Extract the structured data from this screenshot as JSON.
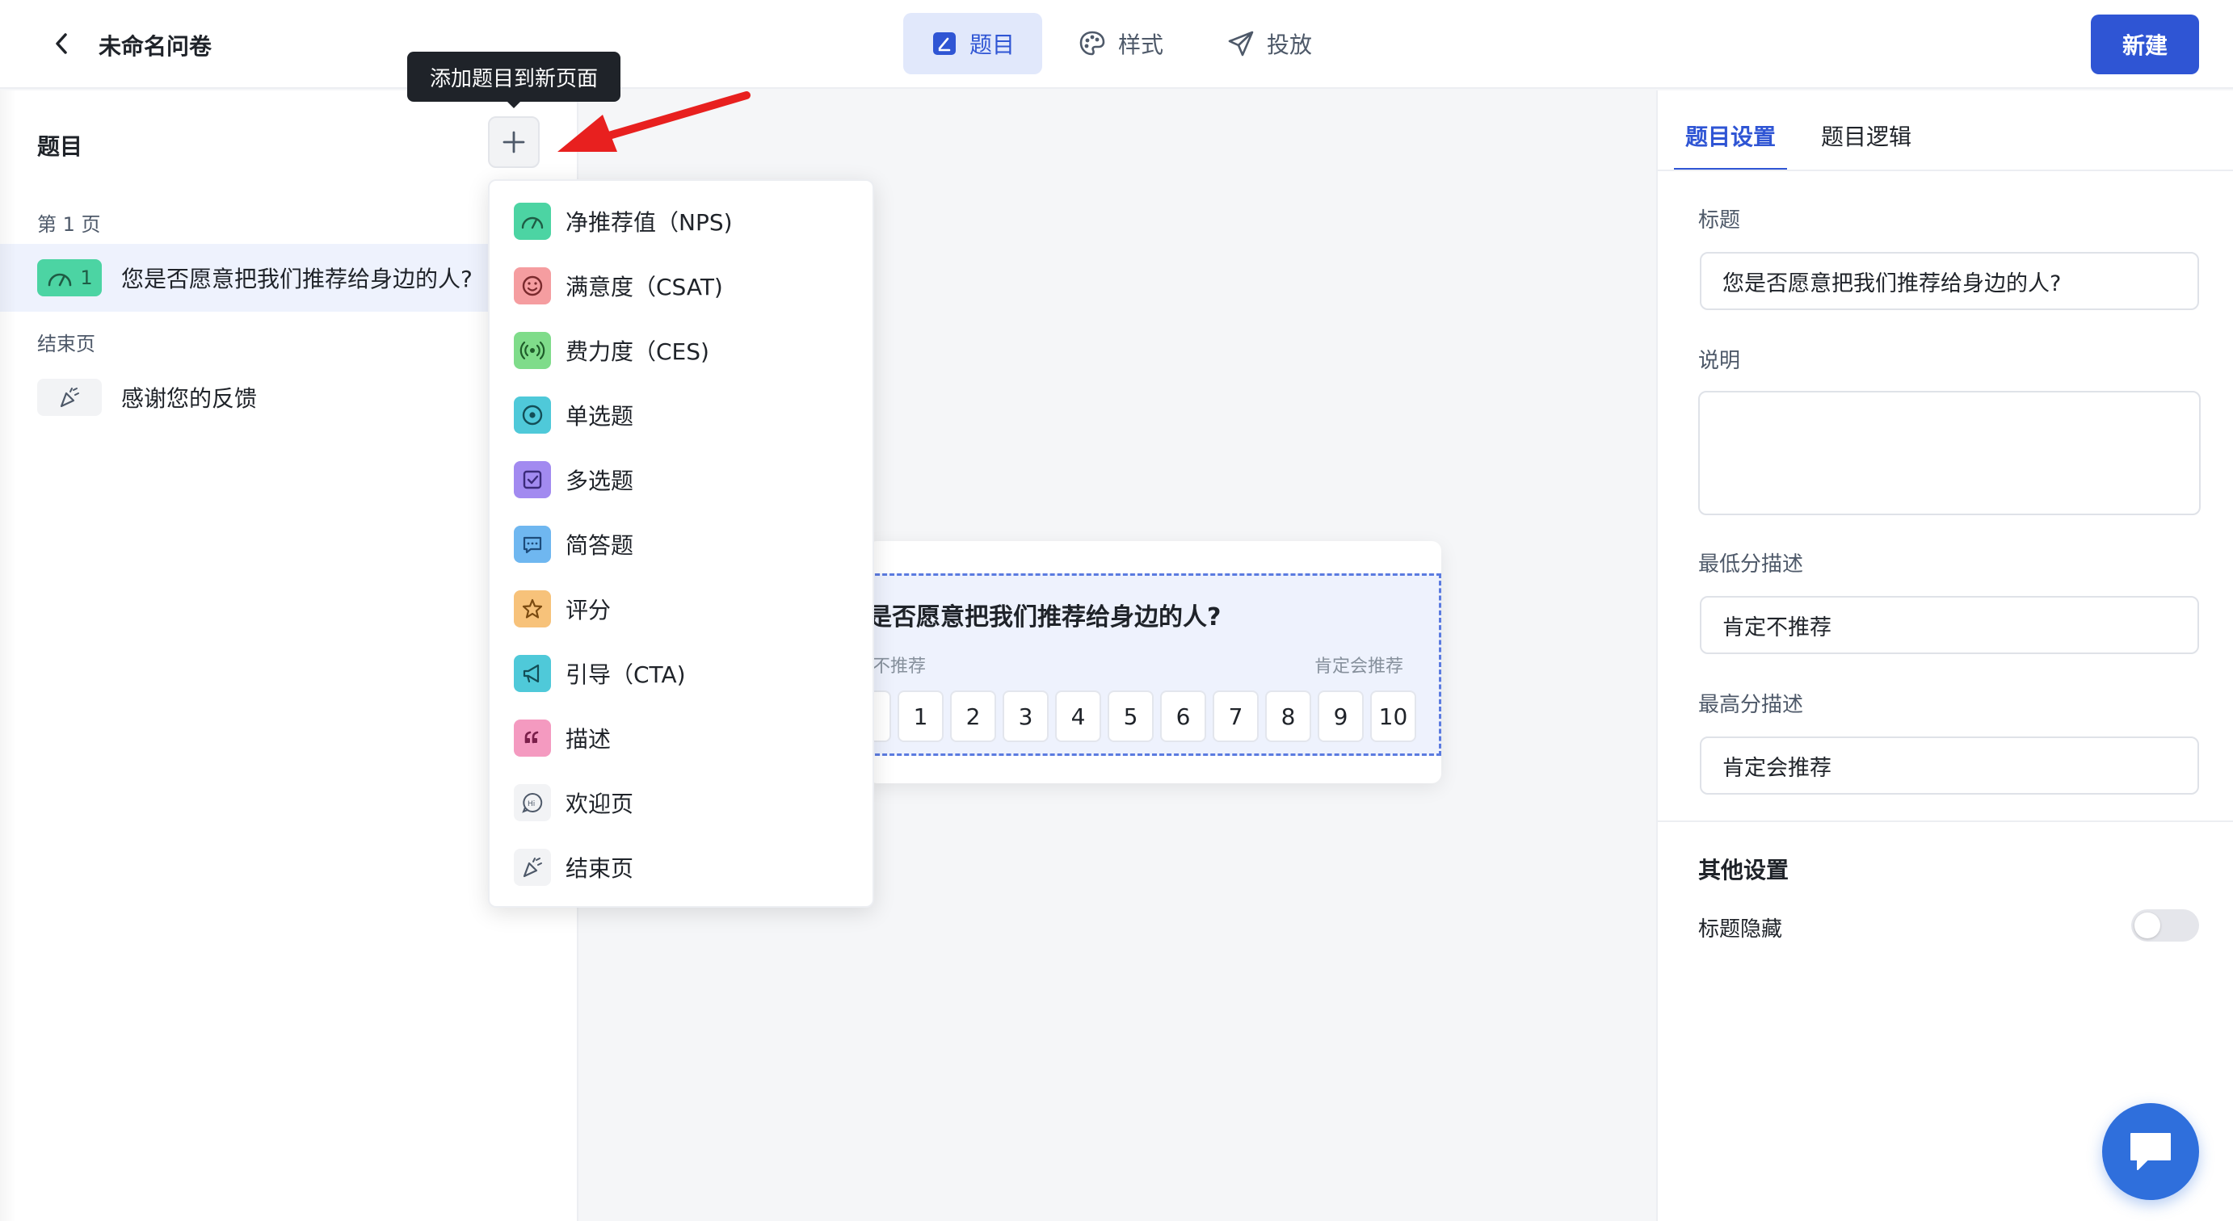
{
  "header": {
    "doc_title": "未命名问卷",
    "tabs": [
      {
        "label": "题目",
        "icon": "edit-note-icon",
        "active": true
      },
      {
        "label": "样式",
        "icon": "palette-icon",
        "active": false
      },
      {
        "label": "投放",
        "icon": "send-icon",
        "active": false
      }
    ],
    "new_button": "新建"
  },
  "left_panel": {
    "title": "题目",
    "tooltip": "添加题目到新页面",
    "page_label": "第 1 页",
    "question": {
      "number": "1",
      "text": "您是否愿意把我们推荐给身边的人?"
    },
    "end_label": "结束页",
    "end_item": "感谢您的反馈"
  },
  "menu": {
    "items": [
      {
        "label": "净推荐值（NPS)",
        "icon": "gauge-icon",
        "color": "#4cd4a3"
      },
      {
        "label": "满意度（CSAT)",
        "icon": "smile-icon",
        "color": "#f59da0"
      },
      {
        "label": "费力度（CES)",
        "icon": "signal-icon",
        "color": "#7fdc8a"
      },
      {
        "label": "单选题",
        "icon": "radio-icon",
        "color": "#4fc9d9"
      },
      {
        "label": "多选题",
        "icon": "checkbox-icon",
        "color": "#a28af0"
      },
      {
        "label": "简答题",
        "icon": "message-icon",
        "color": "#6fb7f0"
      },
      {
        "label": "评分",
        "icon": "star-icon",
        "color": "#f7c27a"
      },
      {
        "label": "引导（CTA)",
        "icon": "megaphone-icon",
        "color": "#4fc9d9"
      },
      {
        "label": "描述",
        "icon": "quote-icon",
        "color": "#f49ac0"
      },
      {
        "label": "欢迎页",
        "icon": "hi-icon",
        "color": "#f2f3f5"
      },
      {
        "label": "结束页",
        "icon": "party-icon",
        "color": "#f2f3f5"
      }
    ]
  },
  "preview": {
    "title": "是否愿意把我们推荐给身边的人?",
    "low_text": "不推荐",
    "high_text": "肯定会推荐",
    "scale": [
      "",
      "1",
      "2",
      "3",
      "4",
      "5",
      "6",
      "7",
      "8",
      "9",
      "10"
    ]
  },
  "right_panel": {
    "tabs": [
      {
        "label": "题目设置",
        "active": true
      },
      {
        "label": "题目逻辑",
        "active": false
      }
    ],
    "title_label": "标题",
    "title_value": "您是否愿意把我们推荐给身边的人?",
    "desc_label": "说明",
    "min_label": "最低分描述",
    "min_value": "肯定不推荐",
    "max_label": "最高分描述",
    "max_value": "肯定会推荐",
    "other_title": "其他设置",
    "hide_title_label": "标题隐藏"
  },
  "colors": {
    "accent": "#2f55d4",
    "nps_green": "#4cd4a3",
    "arrow_red": "#e8201f"
  }
}
